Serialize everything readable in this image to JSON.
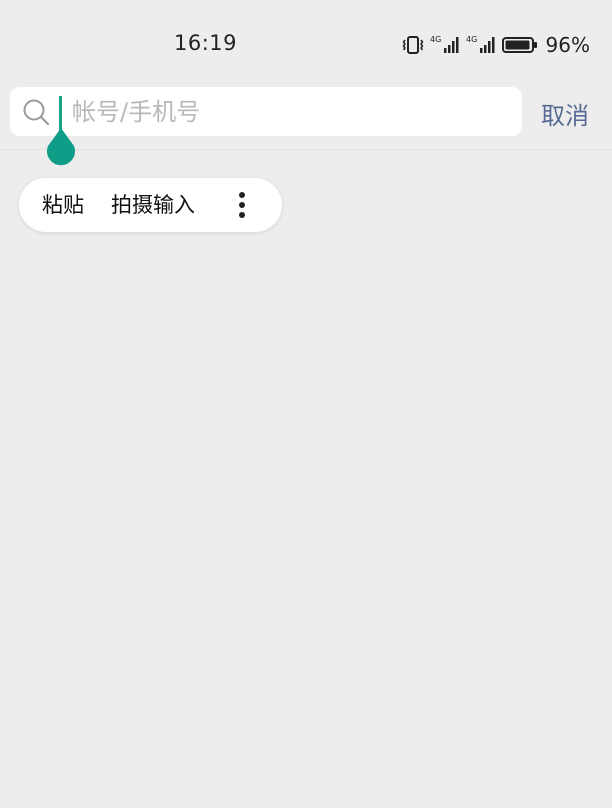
{
  "status_bar": {
    "time": "16:19",
    "network_1": "4G",
    "network_2": "4G",
    "battery_percent": "96%",
    "battery_level": 0.96
  },
  "search": {
    "placeholder": "帐号/手机号",
    "value": "",
    "cancel_label": "取消"
  },
  "context_menu": {
    "items": [
      {
        "label": "粘贴"
      },
      {
        "label": "拍摄输入"
      }
    ],
    "more_icon": "more-vertical-icon"
  },
  "colors": {
    "background": "#ededed",
    "accent_cursor": "#1aa584",
    "handle": "#0e9e87",
    "link": "#576b95"
  }
}
